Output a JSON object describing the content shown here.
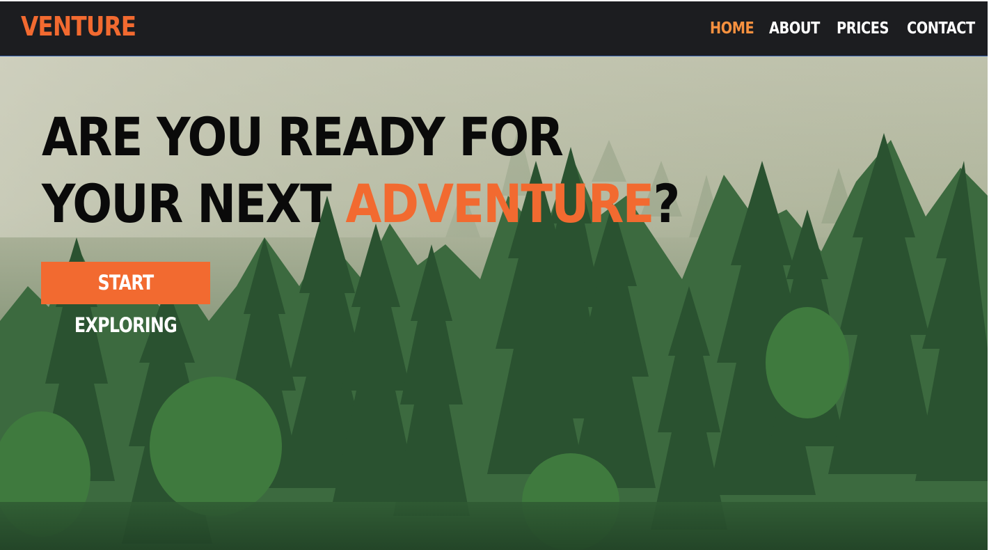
{
  "brand": {
    "logo": "VENTURE",
    "accent_color": "#f26a30",
    "nav_bg": "#1c1d20"
  },
  "nav": {
    "items": [
      {
        "label": "HOME",
        "active": true
      },
      {
        "label": "ABOUT",
        "active": false
      },
      {
        "label": "PRICES",
        "active": false
      },
      {
        "label": "CONTACT",
        "active": false
      }
    ]
  },
  "hero": {
    "headline_line1": "ARE YOU READY FOR",
    "headline_line2_prefix": "YOUR NEXT ",
    "headline_accent": "ADVENTURE",
    "headline_suffix": "?",
    "cta_label": "START EXPLORING",
    "background_image": "misty pine forest"
  }
}
